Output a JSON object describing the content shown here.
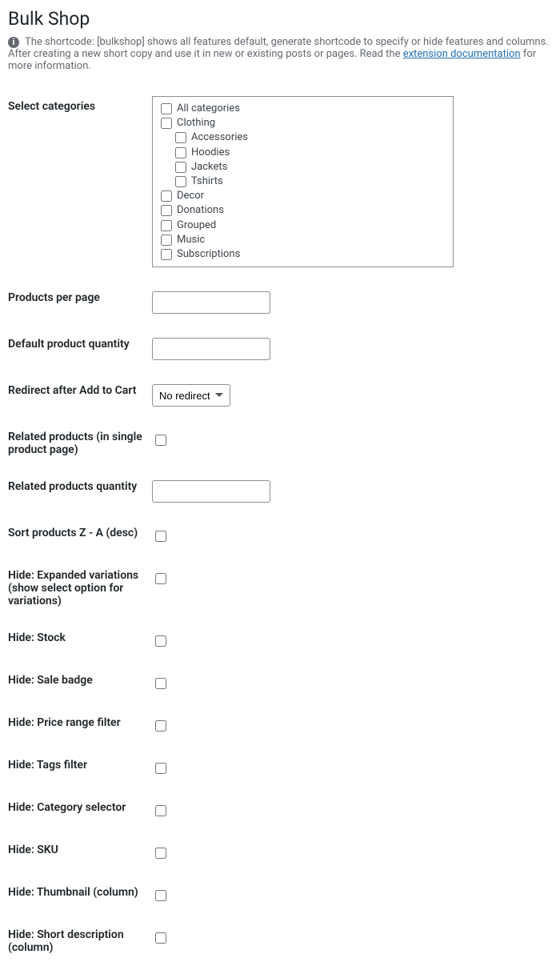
{
  "title": "Bulk Shop",
  "description": {
    "prefix": "The shortcode: [bulkshop] shows all features default, generate shortcode to specify or hide features and columns. After creating a new short copy and use it in new or existing posts or pages. Read the ",
    "link_text": "extension documentation",
    "suffix": " for more information."
  },
  "fields": {
    "select_categories": "Select categories",
    "products_per_page": "Products per page",
    "default_product_quantity": "Default product quantity",
    "redirect_after_add": "Redirect after Add to Cart",
    "related_products": "Related products (in single product page)",
    "related_products_qty": "Related products quantity",
    "sort_z_a": "Sort products Z - A (desc)",
    "hide_expanded": "Hide: Expanded variations (show select option for variations)",
    "hide_stock": "Hide: Stock",
    "hide_sale_badge": "Hide: Sale badge",
    "hide_price_range": "Hide: Price range filter",
    "hide_tags_filter": "Hide: Tags filter",
    "hide_category_selector": "Hide: Category selector",
    "hide_sku": "Hide: SKU",
    "hide_thumbnail": "Hide: Thumbnail (column)",
    "hide_short_description": "Hide: Short description (column)"
  },
  "categories": [
    {
      "label": "All categories",
      "indent": 0
    },
    {
      "label": "Clothing",
      "indent": 0
    },
    {
      "label": "Accessories",
      "indent": 1
    },
    {
      "label": "Hoodies",
      "indent": 1
    },
    {
      "label": "Jackets",
      "indent": 1
    },
    {
      "label": "Tshirts",
      "indent": 1
    },
    {
      "label": "Decor",
      "indent": 0
    },
    {
      "label": "Donations",
      "indent": 0
    },
    {
      "label": "Grouped",
      "indent": 0
    },
    {
      "label": "Music",
      "indent": 0
    },
    {
      "label": "Subscriptions",
      "indent": 0
    }
  ],
  "redirect_options": {
    "selected": "No redirect"
  }
}
